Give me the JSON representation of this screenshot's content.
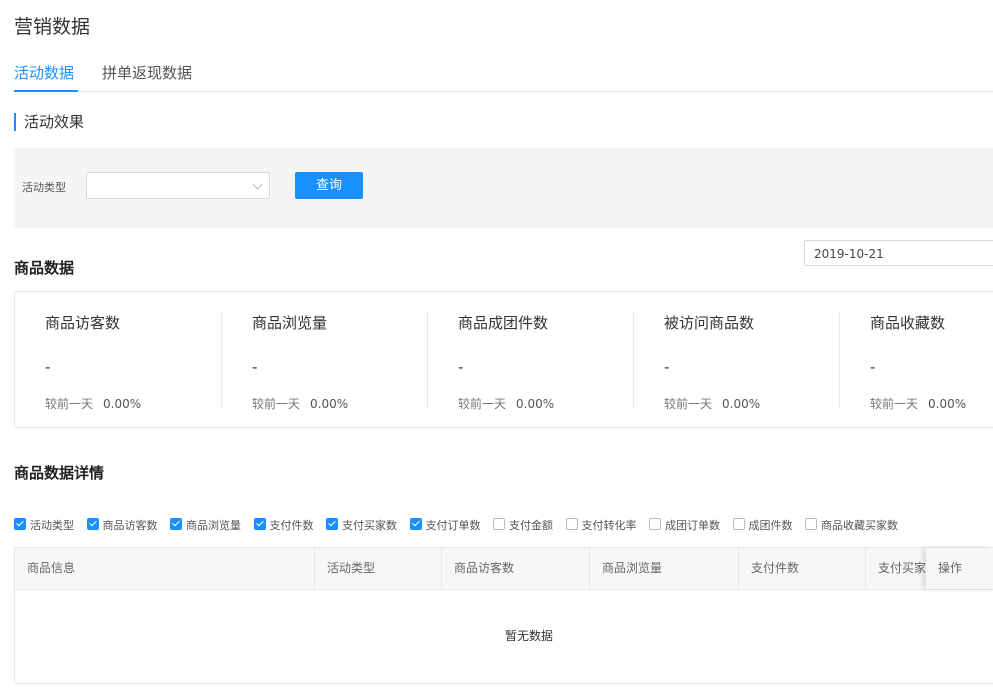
{
  "page": {
    "title": "营销数据"
  },
  "tabs": [
    {
      "label": "活动数据",
      "active": true
    },
    {
      "label": "拼单返现数据",
      "active": false
    }
  ],
  "activity_effect": {
    "title": "活动效果",
    "filter_label": "活动类型",
    "select_value": "",
    "query_button": "查询"
  },
  "goods_data": {
    "title": "商品数据",
    "date": "2019-10-21",
    "stats": [
      {
        "label": "商品访客数",
        "value": "-",
        "compare_label": "较前一天",
        "compare_pct": "0.00%"
      },
      {
        "label": "商品浏览量",
        "value": "-",
        "compare_label": "较前一天",
        "compare_pct": "0.00%"
      },
      {
        "label": "商品成团件数",
        "value": "-",
        "compare_label": "较前一天",
        "compare_pct": "0.00%"
      },
      {
        "label": "被访问商品数",
        "value": "-",
        "compare_label": "较前一天",
        "compare_pct": "0.00%"
      },
      {
        "label": "商品收藏数",
        "value": "-",
        "compare_label": "较前一天",
        "compare_pct": "0.00%"
      }
    ]
  },
  "details": {
    "title": "商品数据详情",
    "columns_toggle": [
      {
        "label": "活动类型",
        "checked": true
      },
      {
        "label": "商品访客数",
        "checked": true
      },
      {
        "label": "商品浏览量",
        "checked": true
      },
      {
        "label": "支付件数",
        "checked": true
      },
      {
        "label": "支付买家数",
        "checked": true
      },
      {
        "label": "支付订单数",
        "checked": true
      },
      {
        "label": "支付金额",
        "checked": false
      },
      {
        "label": "支付转化率",
        "checked": false
      },
      {
        "label": "成团订单数",
        "checked": false
      },
      {
        "label": "成团件数",
        "checked": false
      },
      {
        "label": "商品收藏买家数",
        "checked": false
      }
    ],
    "table": {
      "headers": [
        "商品信息",
        "活动类型",
        "商品访客数",
        "商品浏览量",
        "支付件数",
        "支付买家数"
      ],
      "fixed_header": "操作",
      "empty_text": "暂无数据"
    }
  }
}
